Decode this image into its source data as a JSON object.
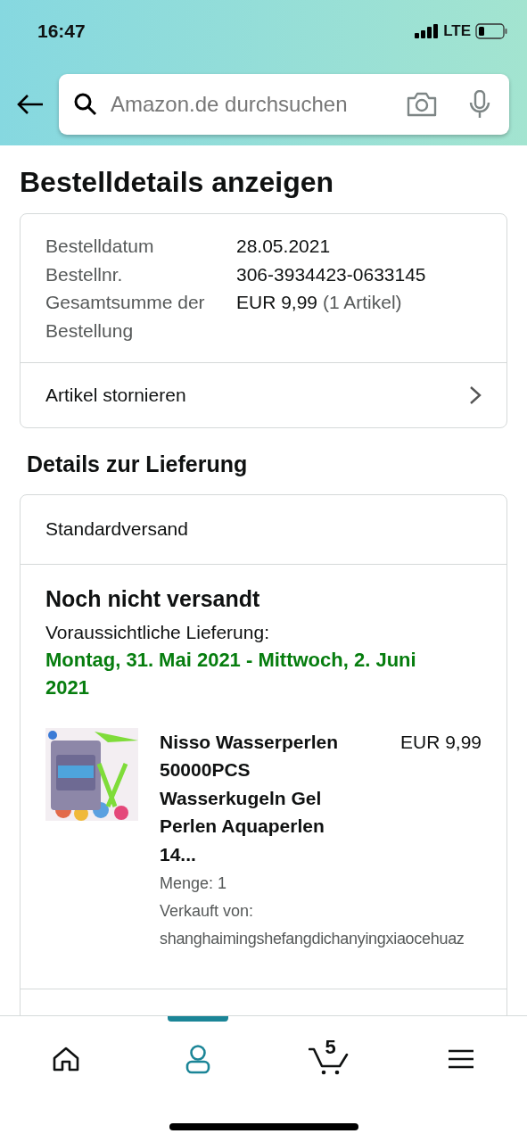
{
  "status_bar": {
    "time": "16:47",
    "network": "LTE"
  },
  "search": {
    "placeholder": "Amazon.de durchsuchen"
  },
  "page_title": "Bestelldetails anzeigen",
  "order_summary": {
    "rows": [
      {
        "label": "Bestelldatum",
        "value": "28.05.2021"
      },
      {
        "label": "Bestellnr.",
        "value": "306-3934423-0633145"
      },
      {
        "label": "Gesamtsumme der Bestellung",
        "value": "EUR 9,99",
        "note": "(1 Artikel)"
      }
    ],
    "link": "Artikel stornieren"
  },
  "delivery_heading": "Details zur Lieferung",
  "shipment": {
    "method": "Standardversand",
    "status": "Noch nicht versandt",
    "estimate_label": "Voraussichtliche Lieferung:",
    "estimate": "Montag, 31. Mai 2021 - Mittwoch, 2. Juni 2021",
    "item": {
      "kind": "picture",
      "title": "Nisso Wasserperlen 50000PCS Wasserkugeln Gel Perlen Aquaperlen 14...",
      "price": "EUR 9,99",
      "quantity": "Menge: 1",
      "seller_label": "Verkauft von:",
      "seller": "shanghaimingshefangdichanyingxiaocehuaz"
    }
  },
  "bottom_nav": [
    {
      "kind": "home",
      "selected": false
    },
    {
      "kind": "account",
      "selected": true
    },
    {
      "kind": "cart",
      "selected": false,
      "count": "5"
    },
    {
      "kind": "menu",
      "selected": false
    }
  ]
}
